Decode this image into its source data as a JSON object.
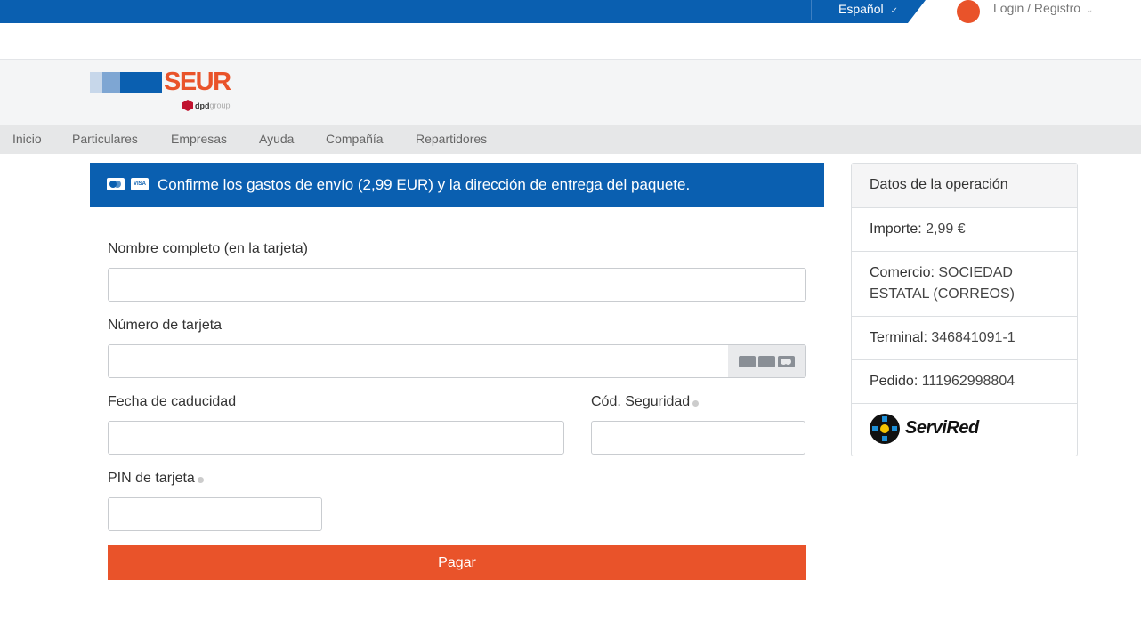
{
  "topbar": {
    "language": "Español",
    "login": "Login / Registro"
  },
  "brand": {
    "logo_text": "SEUR",
    "sub_text": "dpd",
    "sub_text2": "group"
  },
  "nav": {
    "items": [
      "Inicio",
      "Particulares",
      "Empresas",
      "Ayuda",
      "Compañía",
      "Repartidores"
    ]
  },
  "banner": {
    "message": "Confirme los gastos de envío (2,99 EUR) y la dirección de entrega del paquete."
  },
  "form": {
    "name_label": "Nombre completo (en la tarjeta)",
    "name_value": "",
    "card_label": "Número de tarjeta",
    "card_value": "",
    "expiry_label": "Fecha de caducidad",
    "expiry_value": "",
    "cvv_label": "Cód. Seguridad",
    "cvv_value": "",
    "pin_label": "PIN de tarjeta",
    "pin_value": "",
    "pay_label": "Pagar"
  },
  "operation": {
    "title": "Datos de la operación",
    "amount_key": "Importe:",
    "amount_value": "2,99 €",
    "merchant_key": "Comercio:",
    "merchant_value": "SOCIEDAD ESTATAL (CORREOS)",
    "terminal_key": "Terminal:",
    "terminal_value": "346841091-1",
    "order_key": "Pedido:",
    "order_value": "111962998804",
    "provider": "ServiRed"
  },
  "colors": {
    "brand_blue": "#0a5fb0",
    "brand_orange": "#e9532a"
  }
}
